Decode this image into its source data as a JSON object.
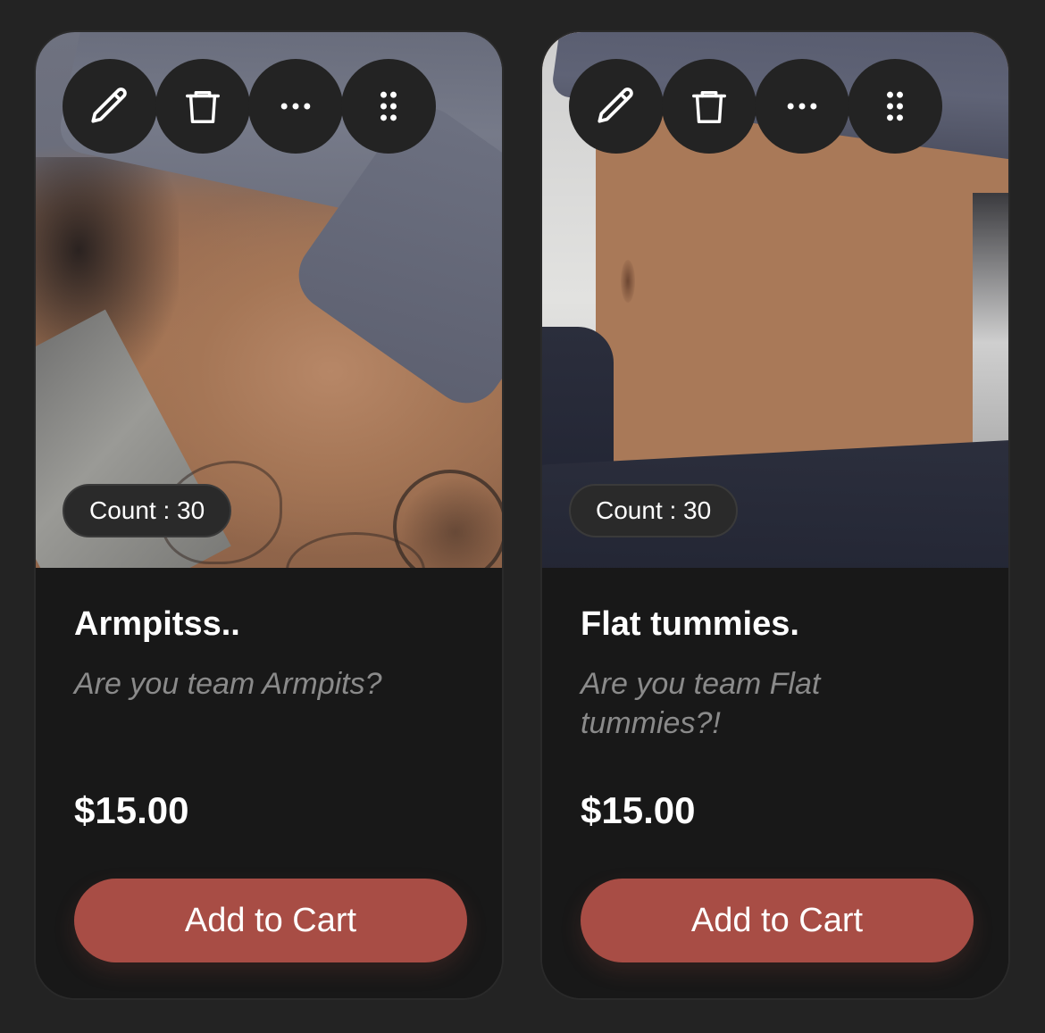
{
  "colors": {
    "page_bg": "#232323",
    "card_bg": "#181818",
    "button_accent": "#a84d45",
    "text_primary": "#ffffff",
    "text_muted": "#8a8a8a"
  },
  "icons": {
    "edit": "pencil-icon",
    "delete": "trash-icon",
    "more": "more-horizontal-icon",
    "drag": "drag-handle-icon"
  },
  "products": [
    {
      "count_label": "Count : 30",
      "title": "Armpitss..",
      "description": "Are you team Armpits?",
      "price": "$15.00",
      "cart_label": "Add to Cart"
    },
    {
      "count_label": "Count : 30",
      "title": "Flat tummies.",
      "description": "Are you team Flat tummies?!",
      "price": "$15.00",
      "cart_label": "Add to Cart"
    }
  ]
}
